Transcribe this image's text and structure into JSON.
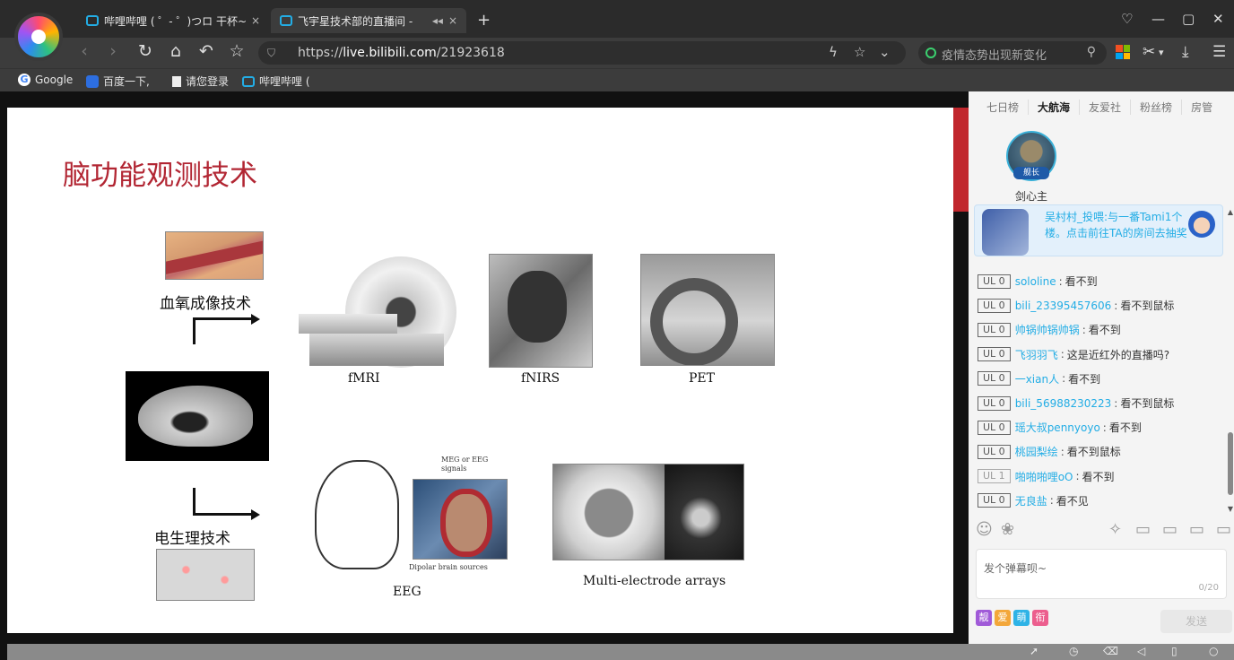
{
  "browser": {
    "tabs": [
      {
        "title": "哔哩哔哩 ( ゜- ゜)つロ 干杯~-",
        "close": "×"
      },
      {
        "title": "飞宇星技术部的直播间 - ",
        "close": "×"
      }
    ],
    "new_tab": "+",
    "url_prefix": "https://",
    "url_host": "live.bilibili.com",
    "url_path": "/21923618",
    "search_placeholder": "疫情态势出现新变化",
    "bookmarks": [
      "Google",
      "百度一下,",
      "请您登录",
      "哔哩哔哩 ("
    ]
  },
  "slide": {
    "title": "脑功能观测技术",
    "label_blood": "血氧成像技术",
    "label_electro": "电生理技术",
    "captions": {
      "fmri": "fMRI",
      "fnirs": "fNIRS",
      "pet": "PET",
      "eeg": "EEG",
      "multi": "Multi-electrode arrays"
    },
    "meg_signals": "MEG or EEG\nsignals",
    "dipolar": "Dipolar brain sources"
  },
  "side": {
    "rank_tabs": [
      "七日榜",
      "大航海",
      "友爱社",
      "粉丝榜",
      "房管"
    ],
    "active_rank_tab": "大航海",
    "guard_badge": "舰长",
    "guard_name": "剑心主",
    "notice_text": "吴村村_投喂:与一番Tami1个楼。点击前往TA的房间去抽奖",
    "danmaku": [
      {
        "ul": "UL 0",
        "name": "sololine",
        "text": "看不到"
      },
      {
        "ul": "UL 0",
        "name": "bili_23395457606",
        "text": "看不到鼠标"
      },
      {
        "ul": "UL 0",
        "name": "帅锅帅锅帅锅",
        "text": "看不到"
      },
      {
        "ul": "UL 0",
        "name": "飞羽羽飞",
        "text": "这是近红外的直播吗?"
      },
      {
        "ul": "UL 0",
        "name": "一xian人",
        "text": "看不到"
      },
      {
        "ul": "UL 0",
        "name": "bili_56988230223",
        "text": "看不到鼠标"
      },
      {
        "ul": "UL 0",
        "name": "瑶大叔pennyoyo",
        "text": "看不到"
      },
      {
        "ul": "UL 0",
        "name": "桃园梨绘",
        "text": "看不到鼠标"
      },
      {
        "ul": "UL 1",
        "name": "啪啪啪哩oO",
        "text": "看不到"
      },
      {
        "ul": "UL 0",
        "name": "无良盐",
        "text": "看不见"
      }
    ],
    "input_placeholder": "发个弹幕呗~",
    "char_count": "0/20",
    "medals": [
      "靓",
      "爱",
      "萌",
      "衔"
    ],
    "send_label": "发送"
  },
  "colors": {
    "bili_blue": "#23ade5",
    "slide_title_red": "#b22633",
    "brand_red": "#c1272d"
  }
}
